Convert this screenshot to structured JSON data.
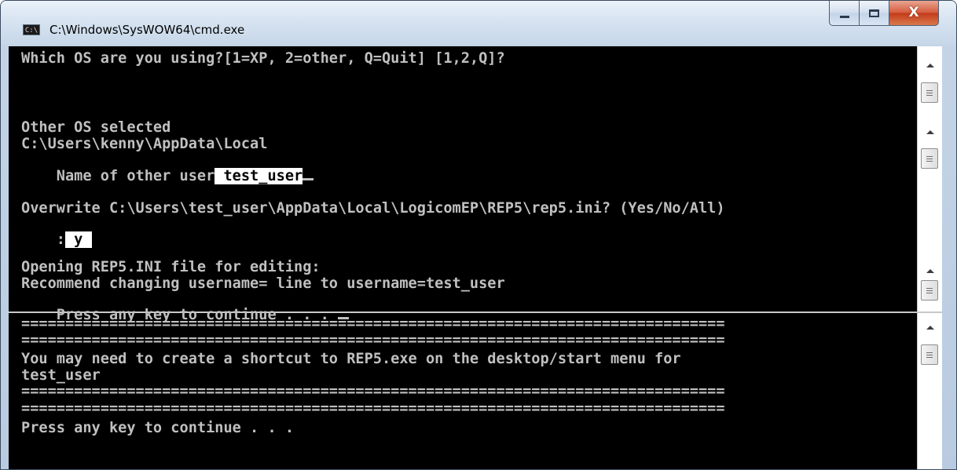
{
  "window": {
    "title": "C:\\Windows\\SysWOW64\\cmd.exe",
    "icon_label": "C:\\",
    "close_label": "X"
  },
  "console": {
    "lines": [
      "Which OS are you using?[1=XP, 2=other, Q=Quit] [1,2,Q]?",
      "Other OS selected",
      "C:\\Users\\kenny\\AppData\\Local",
      "Name of other user",
      "Overwrite C:\\Users\\test_user\\AppData\\Local\\LogicomEP\\REP5\\rep5.ini? (Yes/No/All)",
      ":",
      "Opening REP5.INI file for editing:",
      "Recommend changing username= line to username=test_user",
      "Press any key to continue . . . ",
      "================================================================================",
      "================================================================================",
      "You may need to create a shortcut to REP5.exe on the desktop/start menu for",
      "test_user",
      "================================================================================",
      "================================================================================",
      "Press any key to continue . . ."
    ],
    "username_input": " test_user",
    "overwrite_input": " y "
  },
  "colors": {
    "console_background": "#000000",
    "console_text": "#c0c0c0",
    "input_highlight": "#ffffff",
    "close_button": "#c94a2c"
  },
  "icons": [
    "cmd-app-icon",
    "minimize-icon",
    "maximize-icon",
    "close-icon",
    "scroll-up-arrow-icon",
    "scroll-thumb-grip-icon"
  ]
}
